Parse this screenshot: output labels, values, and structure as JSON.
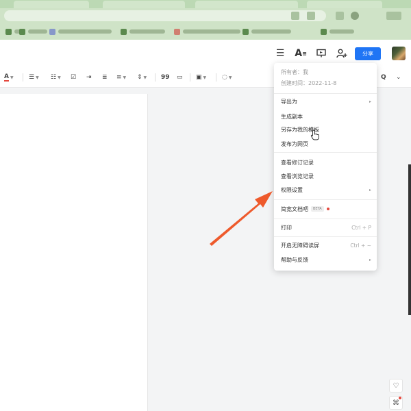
{
  "header": {
    "share_label": "分享"
  },
  "toolbar": {
    "font_color_label": "A",
    "quote_label": "99"
  },
  "menu": {
    "owner": "所有者：我",
    "created": "创建时间：2022-11-8",
    "items": [
      {
        "label": "导出为",
        "has_submenu": true
      },
      {
        "label": "生成副本"
      },
      {
        "label": "另存为我的模板"
      },
      {
        "label": "发布为网页"
      },
      {
        "label": "查看修订记录"
      },
      {
        "label": "查看浏览记录"
      },
      {
        "label": "权限设置",
        "has_submenu": true
      },
      {
        "label": "简宽文档吧",
        "beta": "BETA",
        "dot": true
      },
      {
        "label": "打印",
        "shortcut": "Ctrl + P"
      },
      {
        "label": "开启无障碍读屏",
        "shortcut": "Ctrl + ~"
      },
      {
        "label": "帮助与反馈",
        "has_submenu": true
      }
    ],
    "submenu_arrow": "▸"
  },
  "icons": {
    "hamburger": "☰",
    "font_size": "A",
    "present": "▭",
    "add_user": "+",
    "search": "Q",
    "chevron": "⌄",
    "heart": "♡",
    "shirt": "⌘"
  },
  "colors": {
    "accent_blue": "#1f75f5",
    "arrow_orange": "#ee5a2c",
    "font_color_underline": "#e5483d"
  }
}
